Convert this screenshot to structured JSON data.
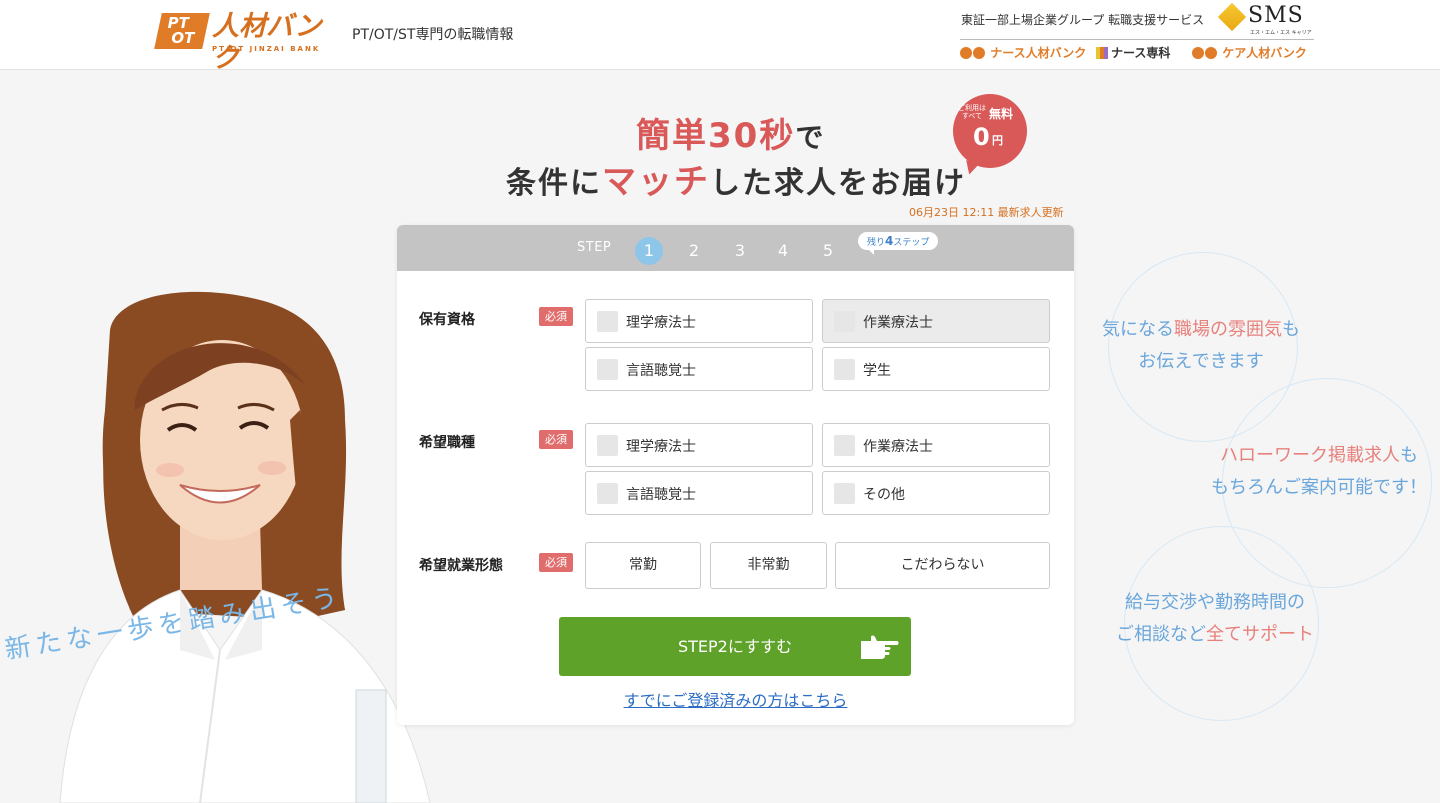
{
  "header": {
    "logo_badge_pt": "PT",
    "logo_badge_ot": "OT",
    "logo_name": "人材バンク",
    "logo_sub": "PT/OT JINZAI BANK",
    "tagline": "PT/OT/ST専門の転職情報",
    "group_text": "東証一部上場企業グループ 転職支援サービス",
    "sms_logo": "SMS",
    "sms_sub": "エス・エム・エス キャリア",
    "brands": {
      "nurse": "ナース人材バンク",
      "senka": "ナース専科",
      "care": "ケア人材バンク"
    }
  },
  "hero": {
    "line1_red": "簡単30秒",
    "line1_dark": "で",
    "line2_a": "条件に",
    "line2_red": "マッチ",
    "line2_b": "した求人をお届け",
    "badge_note": "ご利用は すべて",
    "badge_label": "無料",
    "badge_price": "0",
    "badge_unit": "円",
    "update_text": "06月23日 12:11 最新求人更新"
  },
  "stepbar": {
    "label": "STEP",
    "steps": [
      "1",
      "2",
      "3",
      "4",
      "5"
    ],
    "active_step": 1,
    "remain_prefix": "残り",
    "remain_num": "4",
    "remain_suffix": "ステップ"
  },
  "form": {
    "qualification": {
      "label": "保有資格",
      "required": "必須",
      "options": [
        "理学療法士",
        "作業療法士",
        "言語聴覚士",
        "学生"
      ]
    },
    "job_type": {
      "label": "希望職種",
      "required": "必須",
      "options": [
        "理学療法士",
        "作業療法士",
        "言語聴覚士",
        "その他"
      ]
    },
    "employment": {
      "label": "希望就業形態",
      "required": "必須",
      "options": [
        "常勤",
        "非常勤",
        "こだわらない"
      ]
    },
    "next_button": "STEP2にすすむ",
    "login_link": "すでにご登録済みの方はこちら"
  },
  "slogan": "新たな一歩を踏み出そう",
  "bubbles": [
    {
      "a": "気になる",
      "pink": "職場の雰囲気",
      "b": "も",
      "line2": "お伝えできます"
    },
    {
      "pink": "ハローワーク掲載求人",
      "b": "も",
      "line2": "もちろんご案内可能です！"
    },
    {
      "a": "給与交渉や勤務時間の",
      "line2_a": "ご相談など",
      "line2_pink": "全てサポート"
    }
  ],
  "colors": {
    "accent_red": "#d95858",
    "brand_orange": "#e07b28",
    "next_green": "#5fa22a",
    "step_active": "#8ec6ea",
    "bubble_blue": "#6aa6db"
  }
}
